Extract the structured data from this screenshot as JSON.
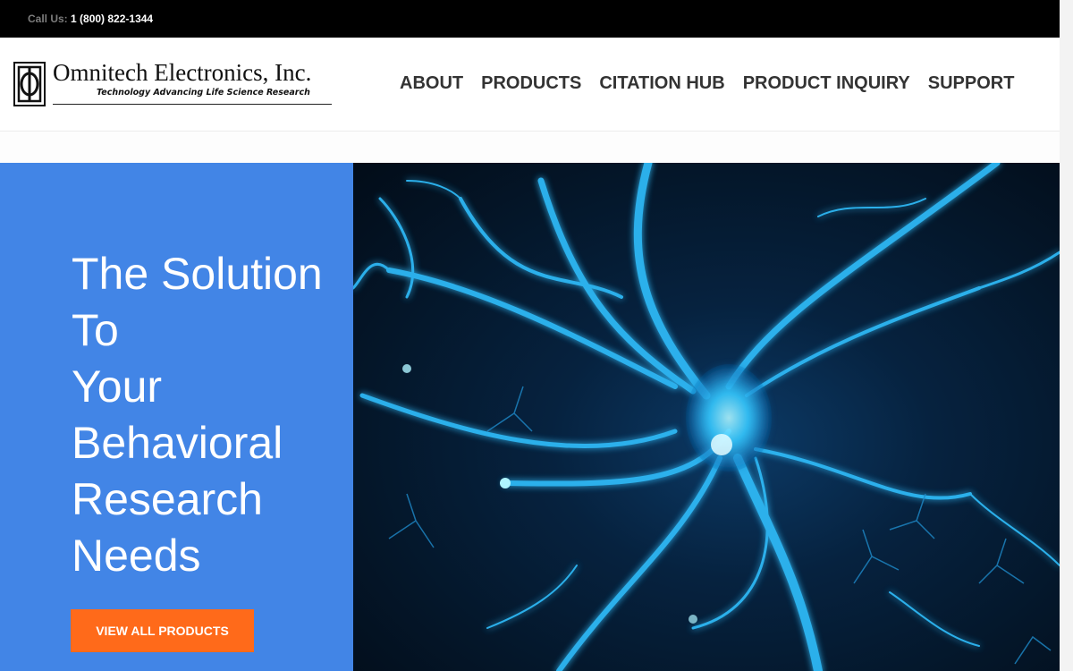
{
  "topbar": {
    "call_label": "Call Us:",
    "phone": "1 (800) 822-1344"
  },
  "brand": {
    "name": "Omnitech Electronics, Inc.",
    "tagline": "Technology Advancing Life Science Research"
  },
  "nav": {
    "items": [
      {
        "label": "ABOUT"
      },
      {
        "label": "PRODUCTS"
      },
      {
        "label": "CITATION HUB"
      },
      {
        "label": "PRODUCT INQUIRY"
      },
      {
        "label": "SUPPORT"
      }
    ]
  },
  "hero": {
    "title_lines": [
      "The Solution",
      "To",
      "Your",
      "Behavioral",
      "Research",
      "Needs"
    ],
    "cta_label": "VIEW ALL PRODUCTS",
    "image": "neuron-illustration"
  },
  "colors": {
    "topbar_bg": "#000000",
    "hero_panel": "#4285e6",
    "cta": "#ff6a1a",
    "neuron_glow": "#34c8ff"
  }
}
